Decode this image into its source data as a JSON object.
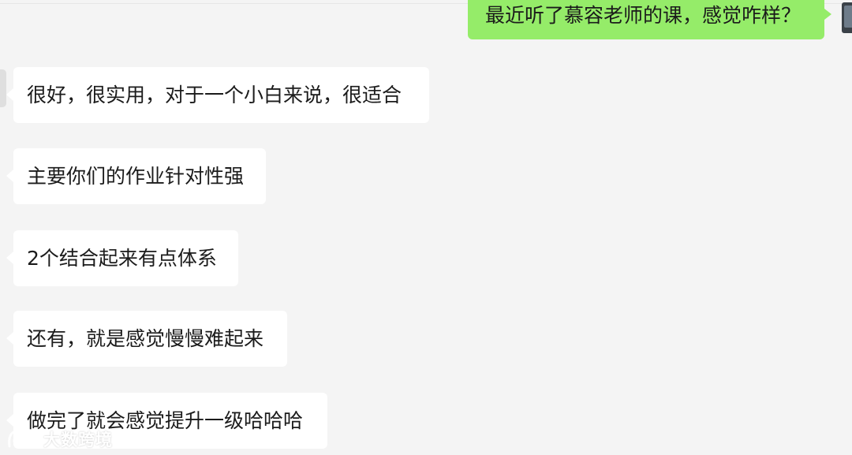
{
  "chat": {
    "outgoing": [
      {
        "text": "最近听了慕容老师的课，感觉咋样？"
      }
    ],
    "incoming": [
      {
        "text": "很好，很实用，对于一个小白来说，很适合"
      },
      {
        "text": "主要你们的作业针对性强"
      },
      {
        "text": "2个结合起来有点体系"
      },
      {
        "text": "还有，就是感觉慢慢难起来"
      },
      {
        "text": "做完了就会感觉提升一级哈哈哈"
      }
    ]
  },
  "watermark": {
    "text": "大数跨境",
    "icon": "brand-logo-icon"
  },
  "colors": {
    "background": "#f4f4f4",
    "outgoing_bubble": "#95ec69",
    "incoming_bubble": "#ffffff",
    "text": "#1b1b1b"
  }
}
